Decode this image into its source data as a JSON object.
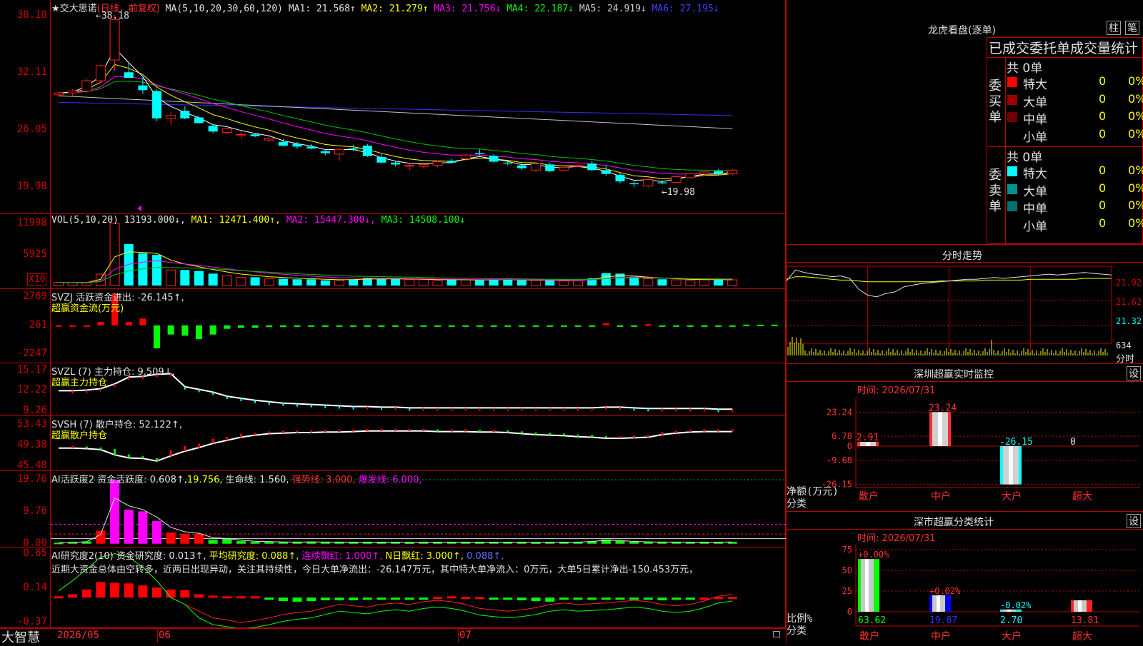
{
  "stock": {
    "title": "★交大思诺",
    "mode": "(日线，前复权)",
    "brand": "大智慧"
  },
  "main": {
    "ma_label": "MA(5,10,20,30,60,120)",
    "ma": [
      {
        "label": "MA1: 21.568↑",
        "color": "#e0e0e0"
      },
      {
        "label": "MA2: 21.279↑",
        "color": "#ffff00"
      },
      {
        "label": "MA3: 21.756↓",
        "color": "#ff00ff"
      },
      {
        "label": "MA4: 22.187↓",
        "color": "#00ff00"
      },
      {
        "label": "MA5: 24.919↓",
        "color": "#d0d0d0"
      },
      {
        "label": "MA6: 27.195↓",
        "color": "#4040ff"
      }
    ],
    "yticks": [
      "38.18",
      "32.11",
      "26.05",
      "19.98"
    ],
    "ytick_values": [
      38.18,
      32.11,
      26.05,
      19.98
    ],
    "high_label": "38.18",
    "low_label": "19.98",
    "ylim": [
      17.5,
      39.5
    ]
  },
  "vol": {
    "label": "VOL(5,10,20)",
    "value": "13193.000↓,",
    "ma": [
      {
        "label": "MA1: 12471.400↑,",
        "color": "#ffff00"
      },
      {
        "label": "MA2: 15447.300↓,",
        "color": "#ff00ff"
      },
      {
        "label": "MA3: 14508.100↓",
        "color": "#00ff00"
      }
    ],
    "yticks": [
      "11998",
      "5925"
    ],
    "ytick_values": [
      11998,
      5925
    ],
    "unit": "X10",
    "ylim": [
      0,
      13500
    ]
  },
  "svzj": {
    "label": "SVZJ  活跃资金进出: -26.145↑,",
    "sub": "超赢资金流(万元)",
    "yticks": [
      "2769",
      "261",
      "-2247"
    ],
    "ytick_values": [
      2769,
      261,
      -2247
    ],
    "ylim": [
      -2800,
      3300
    ]
  },
  "svzl": {
    "label": "SVZL (7) 主力持仓: 9.509↓,",
    "sub": "超赢主力持仓",
    "yticks": [
      "15.17",
      "12.22",
      "9.26"
    ],
    "ytick_values": [
      15.17,
      12.22,
      9.26
    ],
    "ylim": [
      8.8,
      16.0
    ]
  },
  "svsh": {
    "label": "SVSH (7) 散户持仓: 52.122↑,",
    "sub": "超赢散户持仓",
    "yticks": [
      "53.43",
      "49.38",
      "45.48"
    ],
    "ytick_values": [
      53.43,
      49.38,
      45.48
    ],
    "ylim": [
      45.0,
      54.8
    ]
  },
  "ai1": {
    "label": "AI活跃度2 资金活跃度: 0.608↑,",
    "v2": "19.756,",
    "v3": "生命线: 1.560,",
    "v4": "强势线: 3.000,",
    "v5": "爆发线: 6.000,",
    "yticks": [
      "19.76",
      "9.76",
      "0.00"
    ],
    "ytick_values": [
      19.76,
      9.76,
      0.0
    ],
    "ylim": [
      -0.5,
      22.0
    ]
  },
  "ai2": {
    "label": "AI研究度2(10) 资金研究度: 0.013↑,",
    "v2": "平均研究度: 0.088↑,",
    "v3": "连续飘红: 1.000↑,",
    "v4": "N日飘红: 3.000↑,",
    "v5": "0.088↑,",
    "comment": "近期大资金总体由空转多，近两日出现异动，关注其持续性，今日大单净流出：-26.147万元，其中特大单净流入：0万元，大单5日累计净出-150.453万元，",
    "yticks": [
      "0.65",
      "0.14",
      "-0.37"
    ],
    "ytick_values": [
      0.65,
      0.14,
      -0.37
    ],
    "ylim": [
      -0.42,
      0.72
    ]
  },
  "dates": [
    "2026/05",
    "06",
    "07"
  ],
  "right": {
    "lhb_title": "龙虎看盘(逐单)",
    "btn_zhu": "柱",
    "btn_bi": "笔",
    "stat_title": "已成交委托单成交量统计",
    "buy_label": "委买单",
    "sell_label": "委卖单",
    "buy_total": "共 0单",
    "sell_total": "共 0单",
    "buy_rows": [
      {
        "name": "特大",
        "color": "#ff0000",
        "val": "0",
        "pct": "0%"
      },
      {
        "name": "大单",
        "color": "#a00000",
        "val": "0",
        "pct": "0%"
      },
      {
        "name": "中单",
        "color": "#700000",
        "val": "0",
        "pct": "0%"
      },
      {
        "name": "小单",
        "color": "",
        "val": "0",
        "pct": "0%"
      }
    ],
    "sell_rows": [
      {
        "name": "特大",
        "color": "#00ffff",
        "val": "0",
        "pct": "0%"
      },
      {
        "name": "大单",
        "color": "#009090",
        "val": "0",
        "pct": "0%"
      },
      {
        "name": "中单",
        "color": "#007070",
        "val": "0",
        "pct": "0%"
      },
      {
        "name": "小单",
        "color": "",
        "val": "0",
        "pct": "0%"
      }
    ],
    "intraday_title": "分时走势",
    "intraday_yticks": [
      "21.92",
      "21.62",
      "21.32",
      "634"
    ],
    "intraday_extra": "分时",
    "monitor_title": "深圳超赢实时监控",
    "monitor_btn": "设",
    "monitor_time": "时间: 2026/07/31",
    "monitor_yticks": [
      "23.24",
      "6.78",
      "0",
      "-9.68",
      "-26.15"
    ],
    "monitor_ylabel": "净额(万元)",
    "monitor_xlabel": "分类",
    "monitor_cats": [
      "散户",
      "中户",
      "大户",
      "超大"
    ],
    "monitor_values": [
      2.91,
      23.24,
      -26.15,
      0
    ],
    "monitor_value_labels": [
      "2.91",
      "23.24",
      "-26.15",
      "0"
    ],
    "class_title": "深市超赢分类统计",
    "class_btn": "设",
    "class_time": "时间: 2026/07/31",
    "class_yticks": [
      "75",
      "50",
      "25",
      "0"
    ],
    "class_ylabel": "比例%",
    "class_xlabel": "分类",
    "class_cats": [
      "散户",
      "中户",
      "大户",
      "超大"
    ],
    "class_values": [
      63.62,
      19.87,
      2.7,
      13.81
    ],
    "class_value_labels": [
      "63.62",
      "19.87",
      "2.70",
      "13.81"
    ],
    "class_change_labels": [
      "+0.00%",
      "+0.02%",
      "-0.02%",
      ""
    ]
  },
  "chart_data": {
    "type": "candlestick",
    "candles": [
      [
        29.8,
        30.1,
        29.6,
        30.0
      ],
      [
        30.0,
        30.4,
        29.7,
        30.2
      ],
      [
        30.2,
        31.5,
        30.0,
        31.3
      ],
      [
        31.3,
        33.0,
        31.0,
        32.9
      ],
      [
        33.5,
        38.3,
        32.3,
        37.8
      ],
      [
        32.2,
        33.2,
        31.6,
        31.6
      ],
      [
        30.8,
        31.8,
        29.9,
        30.3
      ],
      [
        30.2,
        30.4,
        27.0,
        27.3
      ],
      [
        27.3,
        28.0,
        26.6,
        27.6
      ],
      [
        28.1,
        28.6,
        27.2,
        27.3
      ],
      [
        27.4,
        27.6,
        26.7,
        26.8
      ],
      [
        26.5,
        26.7,
        25.7,
        25.9
      ],
      [
        25.8,
        26.3,
        25.6,
        26.2
      ],
      [
        25.6,
        25.9,
        25.1,
        25.6
      ],
      [
        25.6,
        25.7,
        25.3,
        25.4
      ],
      [
        25.0,
        25.4,
        24.8,
        25.2
      ],
      [
        24.8,
        25.1,
        24.3,
        24.4
      ],
      [
        24.6,
        24.8,
        24.1,
        24.3
      ],
      [
        24.3,
        24.6,
        24.0,
        24.1
      ],
      [
        23.8,
        24.0,
        23.4,
        23.6
      ],
      [
        23.5,
        24.2,
        22.8,
        24.0
      ],
      [
        24.1,
        24.5,
        23.8,
        24.0
      ],
      [
        24.4,
        24.6,
        23.2,
        23.3
      ],
      [
        23.2,
        23.5,
        22.5,
        22.6
      ],
      [
        22.6,
        22.8,
        22.2,
        22.4
      ],
      [
        22.3,
        22.5,
        21.8,
        22.3
      ],
      [
        22.2,
        22.6,
        22.0,
        22.4
      ],
      [
        22.3,
        22.8,
        22.1,
        22.7
      ],
      [
        22.8,
        23.0,
        22.5,
        22.6
      ],
      [
        23.0,
        23.5,
        22.8,
        23.4
      ],
      [
        23.6,
        24.0,
        23.4,
        23.5
      ],
      [
        23.3,
        23.5,
        22.6,
        22.7
      ],
      [
        22.6,
        22.8,
        22.3,
        22.5
      ],
      [
        22.3,
        22.5,
        21.8,
        22.0
      ],
      [
        21.8,
        22.6,
        21.6,
        22.5
      ],
      [
        22.4,
        22.6,
        21.6,
        21.7
      ],
      [
        21.8,
        22.2,
        21.7,
        22.1
      ],
      [
        22.2,
        22.4,
        22.1,
        22.3
      ],
      [
        22.5,
        22.8,
        21.7,
        21.8
      ],
      [
        21.8,
        22.3,
        21.2,
        21.4
      ],
      [
        21.3,
        21.5,
        20.4,
        20.6
      ],
      [
        20.4,
        20.6,
        20.0,
        20.3
      ],
      [
        20.1,
        20.9,
        19.98,
        20.8
      ],
      [
        20.5,
        20.7,
        20.3,
        20.4
      ],
      [
        20.5,
        21.2,
        20.4,
        21.1
      ],
      [
        21.0,
        21.5,
        20.9,
        21.4
      ],
      [
        21.4,
        21.7,
        21.2,
        21.6
      ],
      [
        21.7,
        21.9,
        21.3,
        21.4
      ],
      [
        21.4,
        21.9,
        21.2,
        21.8
      ]
    ],
    "vol": [
      600,
      600,
      500,
      2200,
      12000,
      8000,
      6200,
      5900,
      3000,
      3000,
      2800,
      2300,
      1900,
      1600,
      1600,
      1300,
      1300,
      1200,
      1200,
      1000,
      1000,
      1200,
      1400,
      1300,
      1300,
      1200,
      1200,
      1000,
      1100,
      1100,
      1000,
      1200,
      1100,
      1000,
      1000,
      1000,
      900,
      1000,
      1400,
      2400,
      2300,
      1700,
      1300,
      1200,
      1100,
      1000,
      1100,
      1100,
      1100
    ],
    "svzj": [
      0,
      0,
      0,
      300,
      2769,
      300,
      600,
      -2000,
      -800,
      -900,
      -1200,
      -800,
      -300,
      -200,
      -200,
      -150,
      -150,
      -100,
      -100,
      -80,
      -80,
      -100,
      -120,
      -100,
      -100,
      -90,
      -90,
      -80,
      -90,
      -80,
      -60,
      -80,
      -70,
      -80,
      -60,
      -70,
      -60,
      -60,
      -80,
      180,
      -90,
      -80,
      100,
      -60,
      -50,
      -40,
      -50,
      -40,
      -30
    ],
    "svzl": [
      12.2,
      12.2,
      12.3,
      12.5,
      13.2,
      14.2,
      14.3,
      14.6,
      14.7,
      12.8,
      12.4,
      12.0,
      11.4,
      11.1,
      10.8,
      10.6,
      10.4,
      10.3,
      10.2,
      10.1,
      10.0,
      9.9,
      9.9,
      9.8,
      9.8,
      9.7,
      9.7,
      9.7,
      9.7,
      9.7,
      9.7,
      9.7,
      9.7,
      9.7,
      9.7,
      9.7,
      9.7,
      9.7,
      9.7,
      9.8,
      9.8,
      9.7,
      9.6,
      9.6,
      9.6,
      9.6,
      9.6,
      9.5,
      9.5
    ],
    "svsh": [
      48.9,
      48.9,
      48.8,
      48.6,
      47.6,
      47.0,
      46.9,
      46.4,
      47.4,
      48.3,
      49.0,
      49.8,
      50.4,
      51.0,
      51.4,
      51.7,
      51.8,
      51.9,
      51.9,
      52.0,
      52.0,
      52.1,
      52.2,
      52.2,
      52.2,
      52.2,
      52.2,
      52.1,
      52.1,
      52.1,
      52.0,
      52.0,
      51.9,
      51.7,
      51.5,
      51.4,
      51.3,
      51.1,
      51.0,
      50.8,
      50.8,
      50.9,
      51.0,
      51.5,
      51.8,
      52.0,
      52.1,
      52.1,
      52.1
    ],
    "ai1": [
      0.3,
      0.5,
      0.7,
      4.0,
      19.8,
      10.5,
      10.0,
      7.0,
      3.5,
      3.0,
      3.0,
      1.2,
      1.5,
      0.8,
      0.6,
      0.6,
      0.5,
      0.5,
      0.6,
      0.5,
      0.5,
      0.5,
      0.5,
      0.5,
      0.5,
      0.4,
      0.5,
      0.5,
      0.5,
      0.5,
      0.5,
      0.5,
      0.5,
      0.5,
      0.4,
      0.5,
      0.5,
      0.5,
      0.8,
      1.3,
      0.9,
      0.6,
      0.5,
      0.5,
      0.5,
      0.5,
      0.5,
      0.5,
      0.6
    ],
    "ai2": [
      0.02,
      0.05,
      0.12,
      0.23,
      0.22,
      0.21,
      0.18,
      0.15,
      0.12,
      0.11,
      0.05,
      0.03,
      0.02,
      0.02,
      0.02,
      -0.03,
      -0.05,
      -0.06,
      -0.05,
      -0.04,
      -0.04,
      -0.04,
      -0.03,
      -0.03,
      -0.02,
      -0.02,
      -0.02,
      0.01,
      0.02,
      0.01,
      0.01,
      -0.02,
      -0.03,
      -0.04,
      -0.05,
      -0.06,
      -0.02,
      -0.02,
      -0.03,
      -0.03,
      -0.02,
      -0.01,
      -0.03,
      -0.04,
      -0.03,
      -0.02,
      0.0,
      0.01,
      0.01
    ],
    "ma_long": {
      "ma5": [
        29.7,
        26.2
      ],
      "ma6": [
        29.0,
        27.6
      ]
    },
    "intraday": {
      "price": [
        21.85,
        21.98,
        21.95,
        21.93,
        21.92,
        21.9,
        21.91,
        21.88,
        21.75,
        21.68,
        21.66,
        21.7,
        21.72,
        21.78,
        21.8,
        21.82,
        21.83,
        21.84,
        21.85,
        21.86,
        21.87,
        21.87,
        21.88,
        21.89,
        21.88,
        21.89,
        21.9,
        21.91,
        21.92,
        21.93,
        21.92,
        21.93,
        21.94,
        21.95,
        21.94,
        21.93,
        21.92
      ],
      "avg": [
        21.87,
        21.9,
        21.9,
        21.89,
        21.88,
        21.87,
        21.86,
        21.86,
        21.85,
        21.84,
        21.84,
        21.84,
        21.84,
        21.84,
        21.84,
        21.84,
        21.84,
        21.85,
        21.85,
        21.85,
        21.85,
        21.85,
        21.86,
        21.86,
        21.86,
        21.86,
        21.86,
        21.87,
        21.87,
        21.87,
        21.87,
        21.87,
        21.87,
        21.88,
        21.88,
        21.88,
        21.88
      ],
      "ylim": [
        21.15,
        22.05
      ]
    }
  }
}
